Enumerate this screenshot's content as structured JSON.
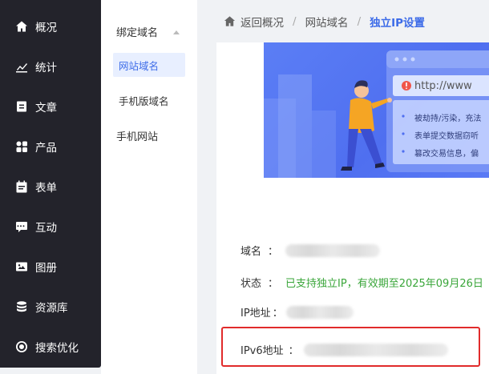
{
  "nav": {
    "items": [
      {
        "label": "概况",
        "icon": "home-icon"
      },
      {
        "label": "统计",
        "icon": "chart-icon"
      },
      {
        "label": "文章",
        "icon": "article-icon"
      },
      {
        "label": "产品",
        "icon": "grid-icon"
      },
      {
        "label": "表单",
        "icon": "calendar-icon"
      },
      {
        "label": "互动",
        "icon": "chat-icon"
      },
      {
        "label": "图册",
        "icon": "album-icon"
      },
      {
        "label": "资源库",
        "icon": "database-icon"
      },
      {
        "label": "搜索优化",
        "icon": "seo-icon"
      }
    ]
  },
  "subnav": {
    "group": "绑定域名",
    "items": [
      "网站域名",
      "手机版域名"
    ],
    "other": "手机网站"
  },
  "breadcrumb": {
    "home": "返回概况",
    "section": "网站域名",
    "current": "独立IP设置"
  },
  "banner": {
    "url_text": "http://www",
    "bullets": [
      "被劫持/污染，充法",
      "表单提交数据窃听",
      "篡改交易信息，偏"
    ]
  },
  "fields": {
    "domain_label": "域名",
    "status_label": "状态",
    "status_value": "已支持独立IP，有效期至2025年09月26日",
    "ip_label": "IP地址",
    "ipv6_label": "IPv6地址",
    "colon": "："
  },
  "colors": {
    "accent": "#3c6be8",
    "success": "#3aa63a",
    "alert": "#e12b2b",
    "nav_bg": "#23232b"
  }
}
